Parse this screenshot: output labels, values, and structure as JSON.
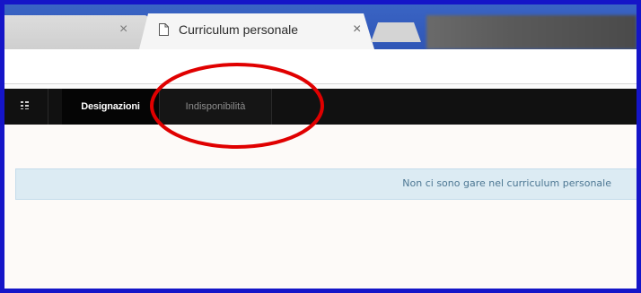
{
  "browser": {
    "tabs": [
      {
        "title": "",
        "close_symbol": "×"
      },
      {
        "title": "Curriculum personale",
        "close_symbol": "×",
        "active": true
      }
    ]
  },
  "navbar": {
    "menu_icon": "grid-menu-icon",
    "tabs": [
      {
        "label": "Designazioni",
        "active": true
      },
      {
        "label": "Indisponibilità",
        "active": false
      }
    ]
  },
  "alert": {
    "message": "Non ci sono gare nel curriculum personale"
  },
  "colors": {
    "frame_border": "#1515c8",
    "navbar_bg": "#111111",
    "alert_bg": "#dcebf3",
    "alert_text": "#4d7793",
    "annotation": "#e00000"
  }
}
